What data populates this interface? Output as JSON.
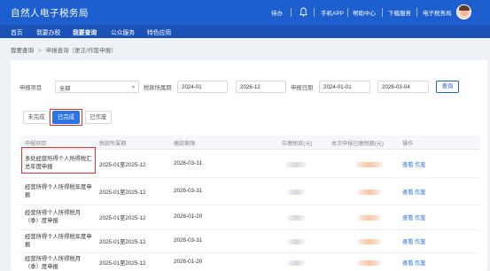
{
  "header": {
    "logo": "自然人电子税务局",
    "items": [
      "待办",
      "手机APP",
      "帮助中心",
      "下载服务",
      "电子税务局"
    ]
  },
  "nav": {
    "items": [
      "首页",
      "我要办税",
      "我要查询",
      "公众服务",
      "特色应用"
    ],
    "active_index": 2
  },
  "breadcrumb": {
    "parent": "我要查询",
    "arrow": ">",
    "current": "申报查询（更正/作废申报）"
  },
  "filters": {
    "project_label": "申报项目",
    "project_value": "全部",
    "period_label": "税款所属期",
    "period_from": "2024-01",
    "period_to": "2026-12",
    "date_label": "申报日期",
    "date_from": "2024-01-01",
    "date_to": "2026-03-04",
    "query_button": "查询"
  },
  "tabs": [
    "未完成",
    "已完成",
    "已作废"
  ],
  "tabs_active_index": 1,
  "table": {
    "columns": [
      "申报项目",
      "税款所属期",
      "缴款期限",
      "应缴税款(元)",
      "本次申报已缴税额(元)",
      "操作"
    ],
    "rows": [
      {
        "project": "多处经营所得个人所得税汇总年度申报",
        "period": "2025-01至2025-12",
        "deadline": "2026-03-31"
      },
      {
        "project": "经营所得个人所得税年度申报",
        "period": "2025-01至2025-12",
        "deadline": "2026-03-31"
      },
      {
        "project": "经营所得个人所得税月（季）度申报",
        "period": "2025-01至2025-12",
        "deadline": "2026-01-20"
      },
      {
        "project": "经营所得个人所得税年度申报",
        "period": "2025-01至2025-12",
        "deadline": "2026-03-31"
      },
      {
        "project": "经营所得个人所得税月（季）度申报",
        "period": "2025-01至2025-12",
        "deadline": "2026-01-20"
      }
    ],
    "actions": {
      "view": "查看",
      "void": "作废"
    }
  },
  "colors": {
    "primary": "#1e5fd0",
    "nav": "#1a52b8",
    "highlight": "#e0342d"
  },
  "icons": [
    "bell-icon",
    "user-avatar-icon",
    "chevron-down-icon"
  ]
}
